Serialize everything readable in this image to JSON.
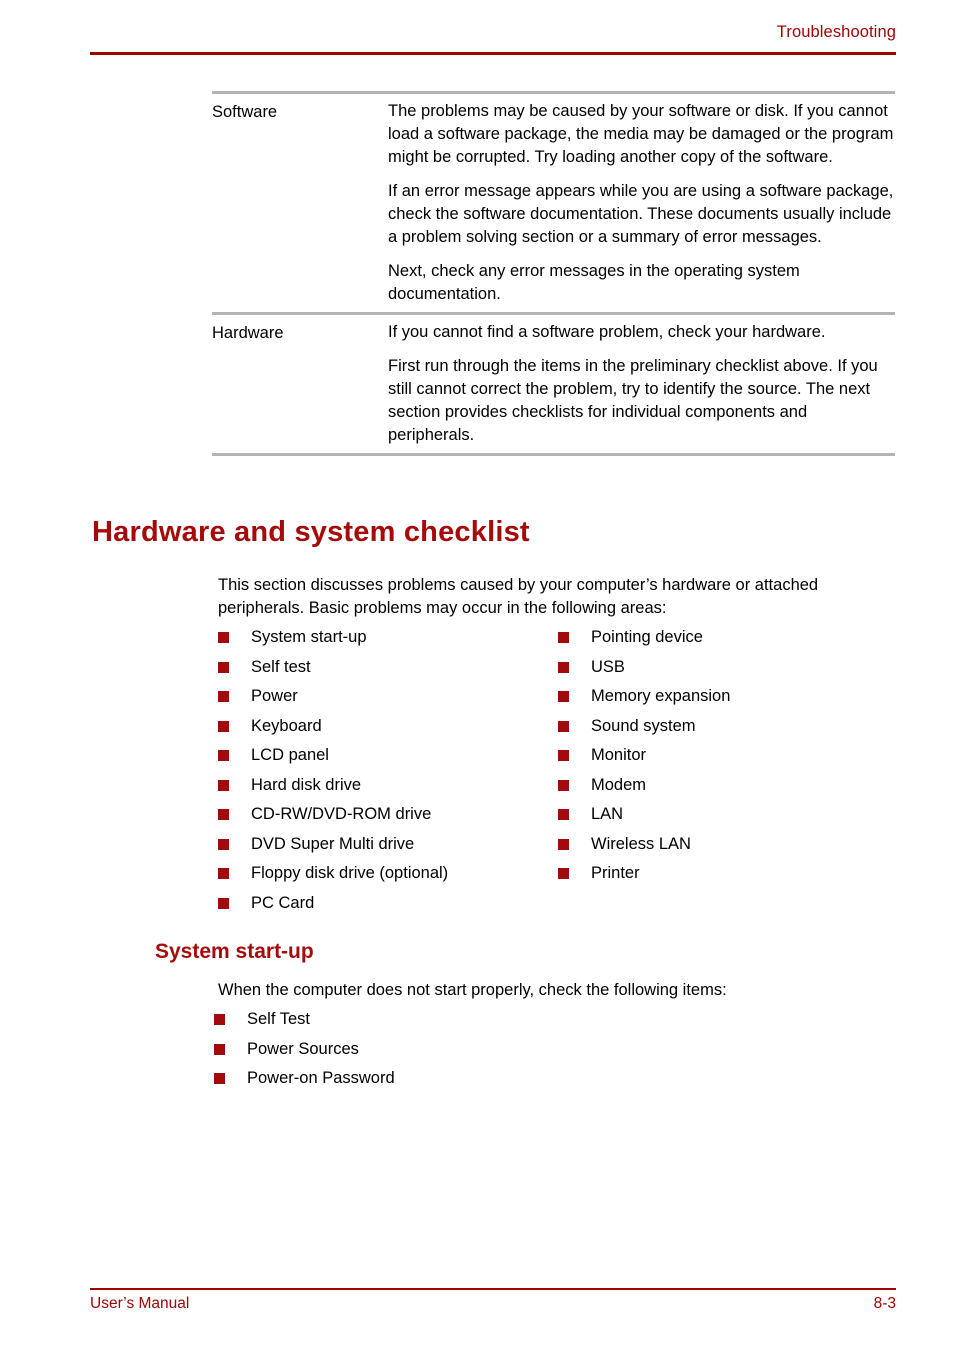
{
  "header": {
    "title": "Troubleshooting",
    "accent_color": "#9e0303"
  },
  "table": {
    "rows": [
      {
        "term": "Software",
        "paragraphs": [
          "The problems may be caused by your software or disk. If you cannot load a software package, the media may be damaged or the program might be corrupted. Try loading another copy of the software.",
          "If an error message appears while you are using a software package, check the software documentation. These documents usually include a problem solving section or a summary of error messages.",
          "Next, check any error messages in the operating system documentation."
        ]
      },
      {
        "term": "Hardware",
        "paragraphs": [
          "If you cannot find a software problem, check your hardware.",
          "First run through the items in the preliminary checklist above. If you still cannot correct the problem, try to identify the source. The next section provides checklists for individual components and peripherals."
        ]
      }
    ]
  },
  "section": {
    "heading": "Hardware and system checklist",
    "intro": "This section discusses problems caused by your computer’s hardware or attached peripherals. Basic problems may occur in the following areas:",
    "checklist_left": [
      "System start-up",
      "Self test",
      "Power",
      "Keyboard",
      "LCD panel",
      "Hard disk drive",
      "CD-RW/DVD-ROM drive",
      "DVD Super Multi drive",
      "Floppy disk drive (optional)",
      "PC Card"
    ],
    "checklist_right": [
      "Pointing device",
      "USB",
      "Memory expansion",
      "Sound system",
      "Monitor",
      "Modem",
      "LAN",
      "Wireless LAN",
      "Printer"
    ]
  },
  "subsection": {
    "heading": "System start-up",
    "intro": "When the computer does not start properly, check the following items:",
    "items": [
      "Self Test",
      "Power Sources",
      "Power-on Password"
    ]
  },
  "footer": {
    "manual_label": "User’s Manual",
    "page_number": "8-3"
  },
  "colors": {
    "heading_red": "#a50b0b",
    "rule_red": "#9e0303",
    "bullet_red": "#a10b0b",
    "table_rule_gray": "#b4b4b4"
  }
}
